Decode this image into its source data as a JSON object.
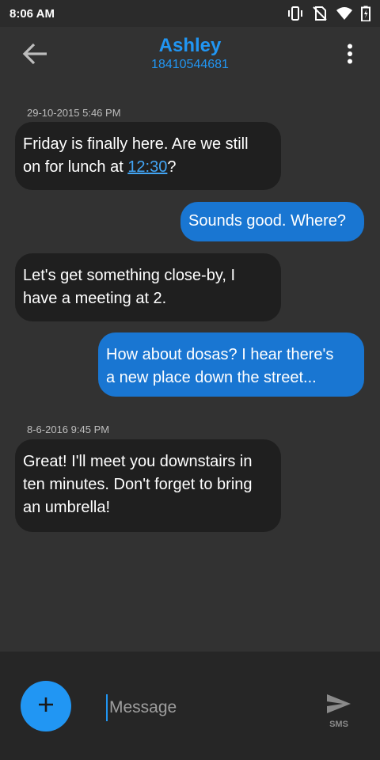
{
  "status_bar": {
    "time": "8:06 AM",
    "icons": [
      "vibrate-icon",
      "no-sim-icon",
      "wifi-icon",
      "battery-icon"
    ]
  },
  "toolbar": {
    "contact_name": "Ashley",
    "contact_number": "18410544681",
    "back_icon": "arrow-back-icon",
    "menu_icon": "more-vert-icon"
  },
  "thread": {
    "timestamps": [
      "29-10-2015 5:46 PM",
      "8-6-2016 9:45 PM"
    ],
    "messages": [
      {
        "direction": "in",
        "lines": [
          "Friday is finally here. Are we still",
          "on for lunch at "
        ],
        "link": "12:30",
        "after_link": "?"
      },
      {
        "direction": "out",
        "lines": [
          "Sounds good. Where?"
        ]
      },
      {
        "direction": "in",
        "lines": [
          "Let's get something close-by, I",
          "have a meeting at 2."
        ]
      },
      {
        "direction": "out",
        "lines": [
          "How about dosas? I hear there's",
          "a new place down the street..."
        ]
      },
      {
        "direction": "in",
        "lines": [
          "Great! I'll meet you downstairs in",
          "ten minutes. Don't forget to bring",
          "an umbrella!"
        ]
      }
    ]
  },
  "compose": {
    "placeholder": "Message",
    "send_label": "SMS",
    "add_icon": "plus-icon",
    "send_icon": "send-icon"
  },
  "colors": {
    "background": "#323232",
    "accent": "#2196f3",
    "incoming_bubble": "#1f1f1f",
    "outgoing_bubble": "#1976d2",
    "compose_bar": "#262626"
  }
}
